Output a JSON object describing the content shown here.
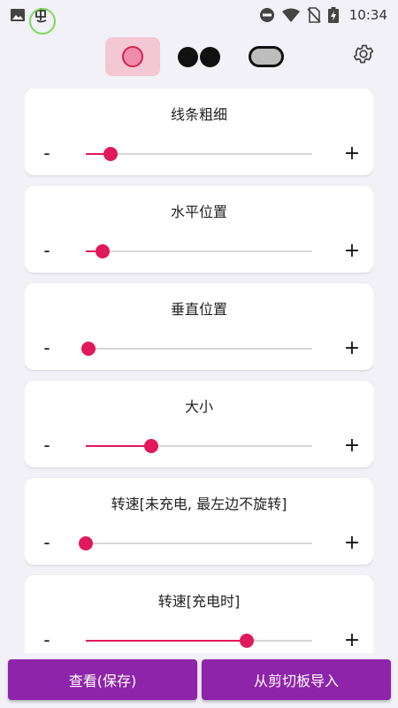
{
  "status_bar": {
    "time": "10:34",
    "icons": [
      "gallery-icon",
      "app-notification-icon",
      "do-not-disturb-icon",
      "wifi-icon",
      "no-sim-icon",
      "battery-charging-icon"
    ]
  },
  "toolbar": {
    "style_options": [
      {
        "name": "single-ring",
        "selected": true
      },
      {
        "name": "double-ring",
        "selected": false
      },
      {
        "name": "pill-ring",
        "selected": false
      }
    ],
    "settings_icon": "gear-icon"
  },
  "sliders": [
    {
      "label": "线条粗细",
      "minus": "-",
      "plus": "+",
      "value": 0.11
    },
    {
      "label": "水平位置",
      "minus": "-",
      "plus": "+",
      "value": 0.075
    },
    {
      "label": "垂直位置",
      "minus": "-",
      "plus": "+",
      "value": 0.01
    },
    {
      "label": "大小",
      "minus": "-",
      "plus": "+",
      "value": 0.29
    },
    {
      "label": "转速[未充电, 最左边不旋转]",
      "minus": "-",
      "plus": "+",
      "value": 0.0
    },
    {
      "label": "转速[充电时]",
      "minus": "-",
      "plus": "+",
      "value": 0.71
    }
  ],
  "buttons": {
    "view_save": "查看(保存)",
    "import_clipboard": "从剪切板导入"
  },
  "colors": {
    "accent": "#e0185c",
    "button": "#8e24aa",
    "selected_bg": "#f3c7d3",
    "background": "#f1f1f7"
  }
}
